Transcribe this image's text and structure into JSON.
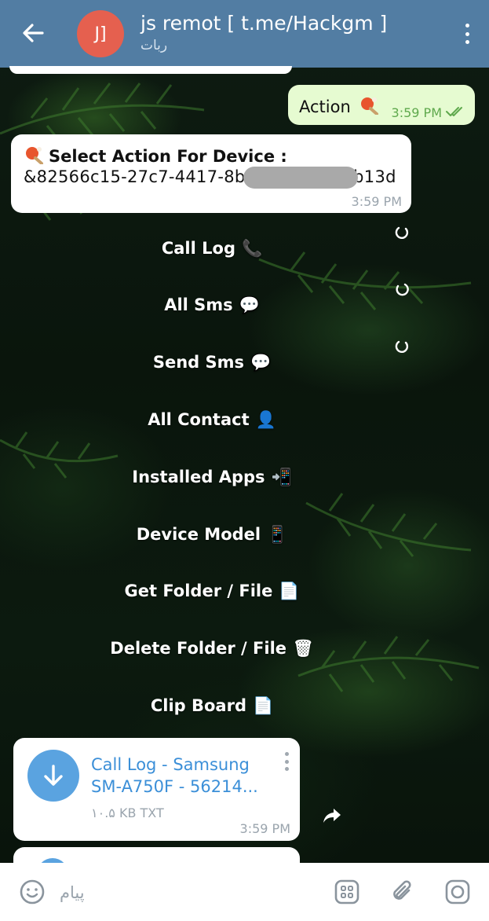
{
  "header": {
    "avatar_initials": "J]",
    "title": "js remot [ t.me/Hackgm ]",
    "subtitle": "ربات",
    "accent_color": "#527da3",
    "avatar_color": "#e5604f"
  },
  "outgoing": {
    "text": "Action",
    "emoji_icon": "ping-pong-icon",
    "time": "3:59 PM",
    "status": "read-double-check-icon"
  },
  "incoming": {
    "line1": "Select Action For Device :",
    "line2_start": "&82566c15-27c7-4417-8b",
    "line2_end": "db13d",
    "emoji_icon": "ping-pong-icon",
    "time": "3:59 PM"
  },
  "actions": [
    {
      "label": "Call Log",
      "icon": "telephone-icon",
      "emoji": "📞"
    },
    {
      "label": "All Sms",
      "icon": "speech-bubble-icon",
      "emoji": "💬"
    },
    {
      "label": "Send Sms",
      "icon": "speech-bubble-icon",
      "emoji": "💬"
    },
    {
      "label": "All Contact",
      "icon": "person-icon",
      "emoji": "👤"
    },
    {
      "label": "Installed Apps",
      "icon": "phone-arrow-icon",
      "emoji": "📲"
    },
    {
      "label": "Device Model",
      "icon": "mobile-phone-icon",
      "emoji": "📱"
    },
    {
      "label": "Get Folder / File",
      "icon": "document-icon",
      "emoji": "📄"
    },
    {
      "label": "Delete Folder / File",
      "icon": "trash-can-icon",
      "emoji": "🗑"
    },
    {
      "label": "Clip Board",
      "icon": "document-icon",
      "emoji": "📄"
    }
  ],
  "file": {
    "name_line1": "Call Log  -  Samsung",
    "name_line2": "SM-A750F  -  56214...",
    "size": "۱۰.۵ KB TXT",
    "time": "3:59 PM"
  },
  "input": {
    "placeholder": "پیام"
  }
}
